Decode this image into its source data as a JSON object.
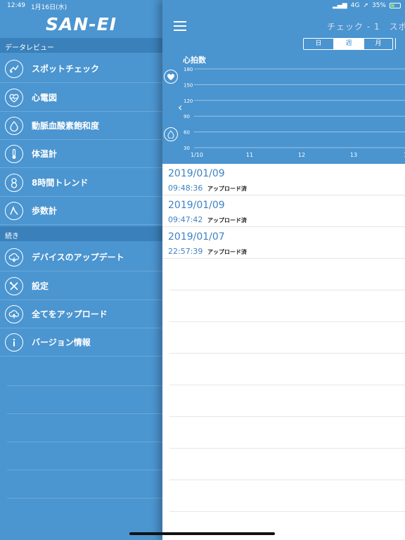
{
  "status": {
    "time": "12:49",
    "date": "1月16日(水)",
    "network": "4G",
    "battery": "35%"
  },
  "sidebar": {
    "logo": "SAN-EI",
    "sections": [
      {
        "title": "データレビュー",
        "items": [
          {
            "label": "スポットチェック",
            "icon": "spot-check-icon"
          },
          {
            "label": "心電図",
            "icon": "ecg-heart-icon"
          },
          {
            "label": "動脈血酸素飽和度",
            "icon": "oxygen-drop-icon"
          },
          {
            "label": "体温計",
            "icon": "thermometer-icon"
          },
          {
            "label": "8時間トレンド",
            "icon": "trend-8h-icon"
          },
          {
            "label": "歩数計",
            "icon": "pedometer-icon"
          }
        ]
      },
      {
        "title": "続き",
        "items": [
          {
            "label": "デバイスのアップデート",
            "icon": "cloud-update-icon"
          },
          {
            "label": "設定",
            "icon": "settings-tools-icon"
          },
          {
            "label": "全てをアップロード",
            "icon": "upload-all-icon"
          },
          {
            "label": "バージョン情報",
            "icon": "info-icon"
          }
        ]
      }
    ]
  },
  "main": {
    "nav_title": "チェック - 1　スポ",
    "segments": [
      "日",
      "週",
      "月"
    ],
    "active_segment": "週",
    "chart_title": "心拍数",
    "records": [
      {
        "date": "2019/01/09",
        "time": "09:48:36",
        "status": "アップロード済"
      },
      {
        "date": "2019/01/09",
        "time": "09:47:42",
        "status": "アップロード済"
      },
      {
        "date": "2019/01/07",
        "time": "22:57:39",
        "status": "アップロード済"
      }
    ]
  },
  "colors": {
    "primary_blue": "#4a94cf",
    "section_blue": "#3a80ba",
    "date_text": "#3e82c3"
  },
  "chart_data": {
    "type": "line",
    "title": "心拍数",
    "y_ticks": [
      180,
      150,
      120,
      90,
      60,
      30
    ],
    "x_ticks": [
      "1/10",
      "11",
      "12",
      "13",
      "1"
    ],
    "ylim": [
      30,
      180
    ],
    "grid": true,
    "series": []
  }
}
